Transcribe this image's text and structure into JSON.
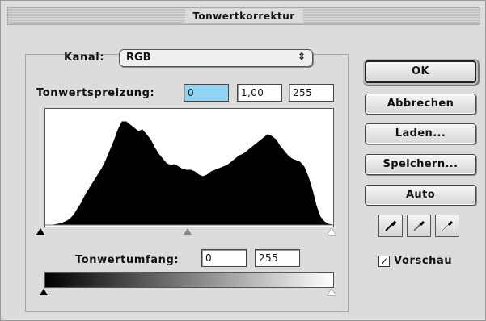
{
  "window": {
    "title": "Tonwertkorrektur"
  },
  "channel": {
    "label": "Kanal:",
    "value": "RGB",
    "arrow": "⇕"
  },
  "input_levels": {
    "label": "Tonwertspreizung:",
    "black": "0",
    "gamma": "1,00",
    "white": "255"
  },
  "output_levels": {
    "label": "Tonwertumfang:",
    "black": "0",
    "white": "255"
  },
  "buttons": {
    "ok": "OK",
    "cancel": "Abbrechen",
    "load": "Laden...",
    "save": "Speichern...",
    "auto": "Auto"
  },
  "preview": {
    "label": "Vorschau",
    "checked": "✓"
  },
  "histogram_ticks": [
    "▲",
    "▲",
    "▲"
  ],
  "colors": {
    "accent_input": "#8fd3f6",
    "histogram": "#000000"
  },
  "icons": [
    "black-eyedropper-icon",
    "gray-eyedropper-icon",
    "white-eyedropper-icon"
  ],
  "histogram_curve": [
    [
      0,
      0
    ],
    [
      5,
      0
    ],
    [
      10,
      0
    ],
    [
      15,
      1
    ],
    [
      20,
      2
    ],
    [
      25,
      4
    ],
    [
      30,
      7
    ],
    [
      35,
      12
    ],
    [
      40,
      20
    ],
    [
      45,
      28
    ],
    [
      50,
      38
    ],
    [
      55,
      46
    ],
    [
      60,
      54
    ],
    [
      65,
      62
    ],
    [
      70,
      70
    ],
    [
      75,
      80
    ],
    [
      80,
      92
    ],
    [
      85,
      104
    ],
    [
      90,
      118
    ],
    [
      95,
      128
    ],
    [
      100,
      128
    ],
    [
      105,
      124
    ],
    [
      110,
      120
    ],
    [
      115,
      116
    ],
    [
      120,
      118
    ],
    [
      125,
      112
    ],
    [
      130,
      106
    ],
    [
      135,
      96
    ],
    [
      140,
      88
    ],
    [
      145,
      82
    ],
    [
      150,
      76
    ],
    [
      155,
      74
    ],
    [
      160,
      75
    ],
    [
      165,
      72
    ],
    [
      170,
      69
    ],
    [
      175,
      68
    ],
    [
      180,
      68
    ],
    [
      185,
      66
    ],
    [
      190,
      62
    ],
    [
      195,
      60
    ],
    [
      200,
      62
    ],
    [
      205,
      66
    ],
    [
      210,
      68
    ],
    [
      215,
      70
    ],
    [
      220,
      72
    ],
    [
      225,
      74
    ],
    [
      230,
      78
    ],
    [
      235,
      82
    ],
    [
      240,
      86
    ],
    [
      245,
      88
    ],
    [
      250,
      92
    ],
    [
      255,
      96
    ],
    [
      260,
      100
    ],
    [
      265,
      104
    ],
    [
      270,
      108
    ],
    [
      275,
      112
    ],
    [
      280,
      110
    ],
    [
      285,
      106
    ],
    [
      290,
      98
    ],
    [
      295,
      92
    ],
    [
      300,
      86
    ],
    [
      305,
      82
    ],
    [
      310,
      80
    ],
    [
      315,
      78
    ],
    [
      320,
      72
    ],
    [
      325,
      60
    ],
    [
      330,
      44
    ],
    [
      335,
      24
    ],
    [
      340,
      10
    ],
    [
      345,
      4
    ],
    [
      350,
      1
    ],
    [
      355,
      0
    ]
  ]
}
